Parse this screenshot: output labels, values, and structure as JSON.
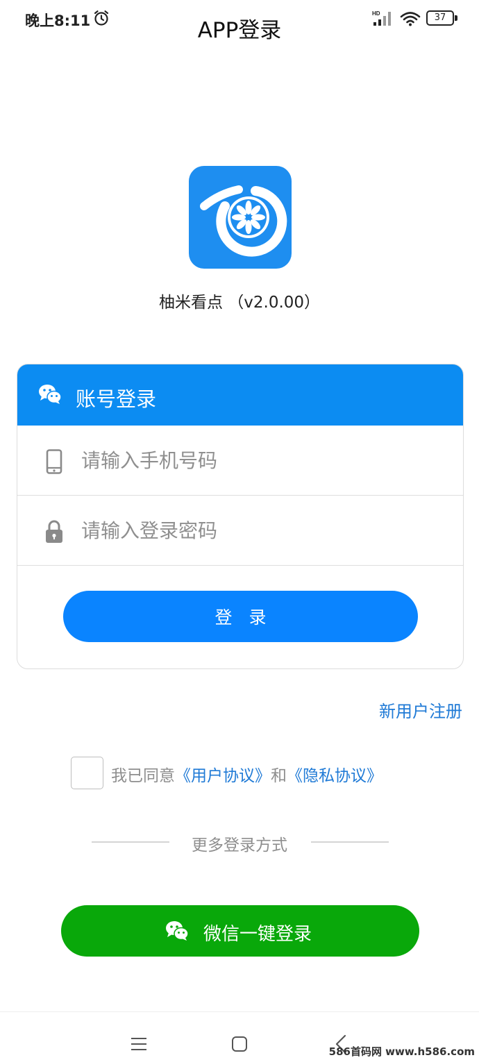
{
  "status_bar": {
    "time": "晚上8:11",
    "battery_level": "37"
  },
  "header": {
    "title": "APP登录"
  },
  "app_info": {
    "name_version": "柚米看点 （v2.0.00）"
  },
  "login_card": {
    "header_title": "账号登录",
    "phone_placeholder": "请输入手机号码",
    "password_placeholder": "请输入登录密码",
    "login_button_label": "登录"
  },
  "register_link": "新用户注册",
  "agreement": {
    "prefix": "我已同意",
    "user_agreement": "《用户协议》",
    "conjunction": "和",
    "privacy_agreement": "《隐私协议》"
  },
  "more_login": {
    "divider_text": "更多登录方式",
    "wechat_button_label": "微信一键登录"
  },
  "watermark": "586首码网 www.h586.com",
  "colors": {
    "header_blue": "#0c8cf2",
    "button_blue": "#0a84ff",
    "link_blue": "#1f7ad6",
    "wechat_green": "#09a80a",
    "logo_blue": "#1e8ef0"
  },
  "icons": {
    "alarm": "alarm-clock-icon",
    "signal": "cellular-signal-icon",
    "wifi": "wifi-icon",
    "card_header": "wechat-icon",
    "phone_field": "mobile-phone-icon",
    "password_field": "lock-icon",
    "wechat_button": "wechat-icon",
    "nav_menu": "menu-icon",
    "nav_home": "home-square-icon",
    "nav_back": "back-chevron-icon"
  }
}
